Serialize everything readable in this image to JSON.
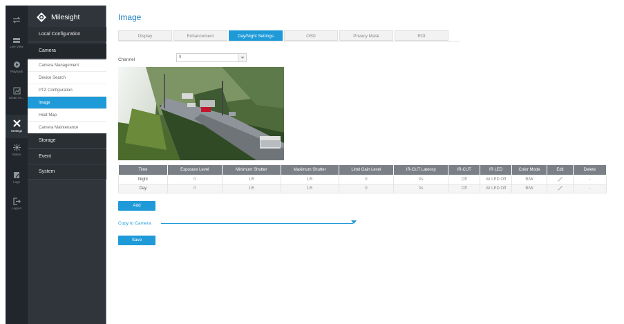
{
  "brand": {
    "name": "Milesight"
  },
  "rail": [
    {
      "icon": "transfer-icon",
      "label": ""
    },
    {
      "icon": "live-view-icon",
      "label": "Live View"
    },
    {
      "icon": "playback-icon",
      "label": "Playback"
    },
    {
      "icon": "smart-analytics-icon",
      "label": "Smart An..."
    },
    {
      "icon": "settings-icon",
      "label": "Settings"
    },
    {
      "icon": "status-icon",
      "label": "Status"
    },
    {
      "icon": "logs-icon",
      "label": "Logs"
    },
    {
      "icon": "logout-icon",
      "label": "Logout"
    }
  ],
  "sidebar": {
    "local_config": "Local Configuration",
    "camera": "Camera",
    "camera_items": [
      "Camera Management",
      "Device Search",
      "PTZ Configuration",
      "Image",
      "Heat Map",
      "Camera Maintenance"
    ],
    "storage": "Storage",
    "event": "Event",
    "system": "System"
  },
  "page": {
    "title": "Image",
    "tabs": [
      "Display",
      "Enhancement",
      "Day/Night Settings",
      "OSD",
      "Privacy Mask",
      "ROI"
    ],
    "active_tab": "Day/Night Settings",
    "channel_label": "Channel",
    "channel_value": "9"
  },
  "table": {
    "headers": [
      "Time",
      "Exposure Level",
      "Minimum Shutter",
      "Maximum Shutter",
      "Limit Gain Level",
      "IR-CUT Latency",
      "IR-CUT",
      "IR LED",
      "Color Mode",
      "Edit",
      "Delete"
    ],
    "rows": [
      [
        "Night",
        "0",
        "1/5",
        "1/5",
        "0",
        "0s",
        "Off",
        "All LED Off",
        "B/W",
        "",
        "-"
      ],
      [
        "Day",
        "0",
        "1/5",
        "1/5",
        "0",
        "0s",
        "Off",
        "All LED Off",
        "B/W",
        "",
        "-"
      ]
    ]
  },
  "buttons": {
    "add": "Add",
    "save": "Save"
  },
  "copy_to_camera": "Copy to Camera",
  "colors": {
    "accent": "#1f9ad8",
    "rail": "#20262b",
    "sidebar": "#2f353b",
    "table_header": "#7b8087"
  }
}
